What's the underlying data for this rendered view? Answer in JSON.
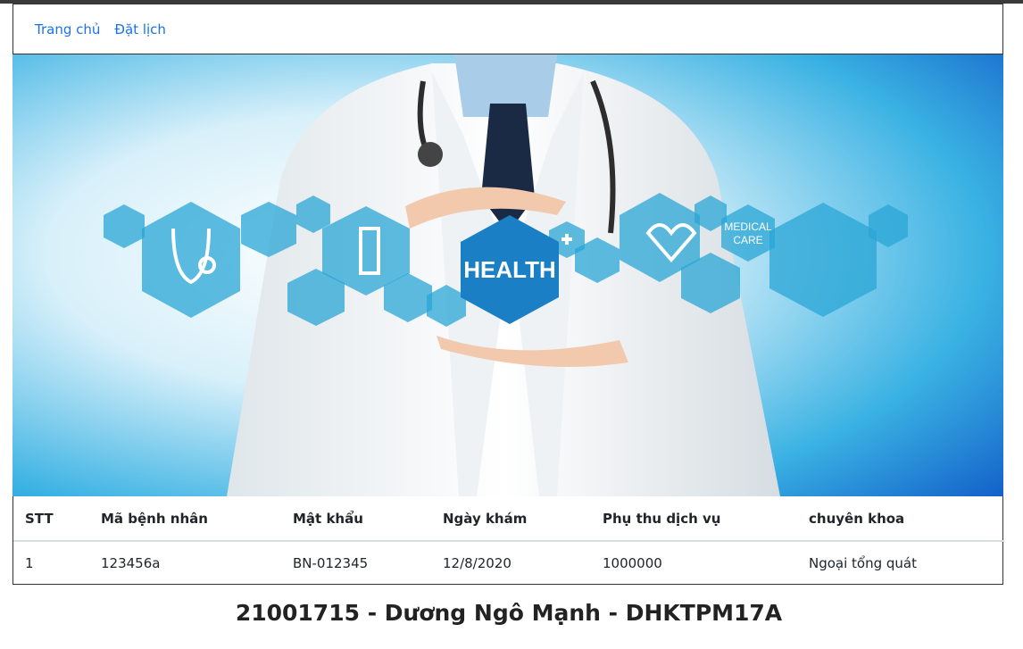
{
  "nav": {
    "home_label": "Trang chủ",
    "booking_label": "Đặt lịch"
  },
  "banner": {
    "center_text": "HEALTH",
    "badge_text_line1": "MEDICAL",
    "badge_text_line2": "CARE",
    "accent_color": "#2aa6d6"
  },
  "table": {
    "headers": [
      "STT",
      "Mã bệnh nhân",
      "Mật khẩu",
      "Ngày khám",
      "Phụ thu dịch vụ",
      "chuyên khoa"
    ],
    "rows": [
      [
        "1",
        "123456a",
        "BN-012345",
        "12/8/2020",
        "1000000",
        "Ngoại tổng quát"
      ]
    ]
  },
  "footer": {
    "text": "21001715 - Dương Ngô Mạnh - DHKTPM17A"
  }
}
